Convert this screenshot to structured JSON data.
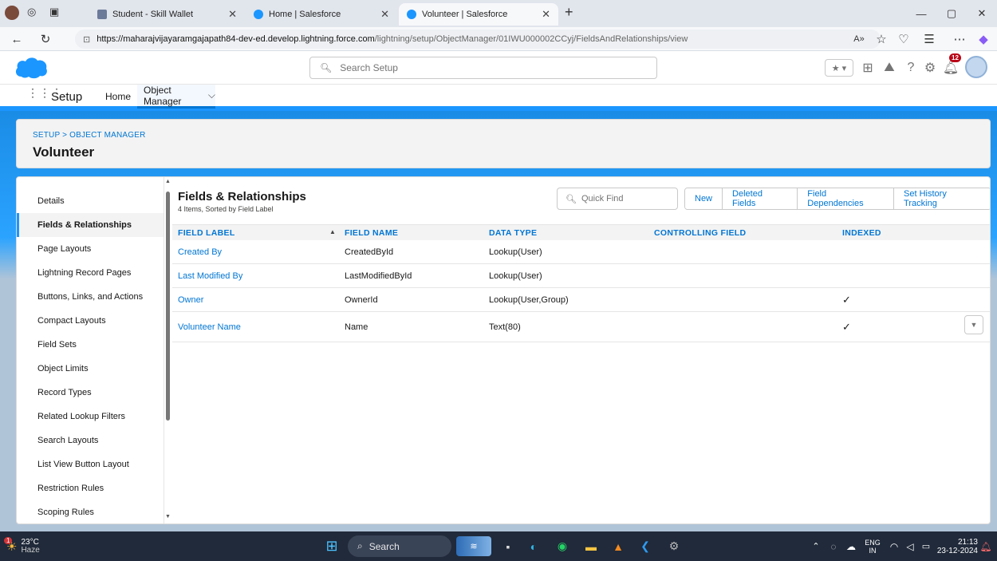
{
  "browser": {
    "tabs": [
      {
        "title": "Student - Skill Wallet",
        "active": false
      },
      {
        "title": "Home | Salesforce",
        "active": false
      },
      {
        "title": "Volunteer | Salesforce",
        "active": true
      }
    ],
    "new_tab": "+",
    "url_host": "https://maharajvijayaramgajapath84-dev-ed.develop.lightning.force.com",
    "url_path": "/lightning/setup/ObjectManager/01IWU000002CCyj/FieldsAndRelationships/view"
  },
  "header": {
    "search_placeholder": "Search Setup",
    "notification_count": "12"
  },
  "nav": {
    "app_name": "Setup",
    "items": [
      "Home",
      "Object Manager"
    ]
  },
  "page": {
    "breadcrumb": "SETUP > OBJECT MANAGER",
    "object_name": "Volunteer"
  },
  "sidebar": {
    "items": [
      {
        "label": "Details",
        "selected": false
      },
      {
        "label": "Fields & Relationships",
        "selected": true
      },
      {
        "label": "Page Layouts",
        "selected": false
      },
      {
        "label": "Lightning Record Pages",
        "selected": false
      },
      {
        "label": "Buttons, Links, and Actions",
        "selected": false
      },
      {
        "label": "Compact Layouts",
        "selected": false
      },
      {
        "label": "Field Sets",
        "selected": false
      },
      {
        "label": "Object Limits",
        "selected": false
      },
      {
        "label": "Record Types",
        "selected": false
      },
      {
        "label": "Related Lookup Filters",
        "selected": false
      },
      {
        "label": "Search Layouts",
        "selected": false
      },
      {
        "label": "List View Button Layout",
        "selected": false
      },
      {
        "label": "Restriction Rules",
        "selected": false
      },
      {
        "label": "Scoping Rules",
        "selected": false
      }
    ]
  },
  "fields": {
    "title": "Fields & Relationships",
    "subtitle": "4 Items, Sorted by Field Label",
    "quick_find_placeholder": "Quick Find",
    "buttons": [
      "New",
      "Deleted Fields",
      "Field Dependencies",
      "Set History Tracking"
    ],
    "columns": [
      "FIELD LABEL",
      "FIELD NAME",
      "DATA TYPE",
      "CONTROLLING FIELD",
      "INDEXED"
    ],
    "rows": [
      {
        "label": "Created By",
        "name": "CreatedById",
        "type": "Lookup(User)",
        "controlling": "",
        "indexed": false
      },
      {
        "label": "Last Modified By",
        "name": "LastModifiedById",
        "type": "Lookup(User)",
        "controlling": "",
        "indexed": false
      },
      {
        "label": "Owner",
        "name": "OwnerId",
        "type": "Lookup(User,Group)",
        "controlling": "",
        "indexed": true
      },
      {
        "label": "Volunteer Name",
        "name": "Name",
        "type": "Text(80)",
        "controlling": "",
        "indexed": true
      }
    ]
  },
  "taskbar": {
    "weather_temp": "23°C",
    "weather_desc": "Haze",
    "weather_badge": "1",
    "search_label": "Search",
    "lang_top": "ENG",
    "lang_bottom": "IN",
    "time": "21:13",
    "date": "23-12-2024"
  },
  "colors": {
    "brand": "#1b96ff",
    "link": "#0176d3",
    "taskbar": "#202a3a"
  }
}
